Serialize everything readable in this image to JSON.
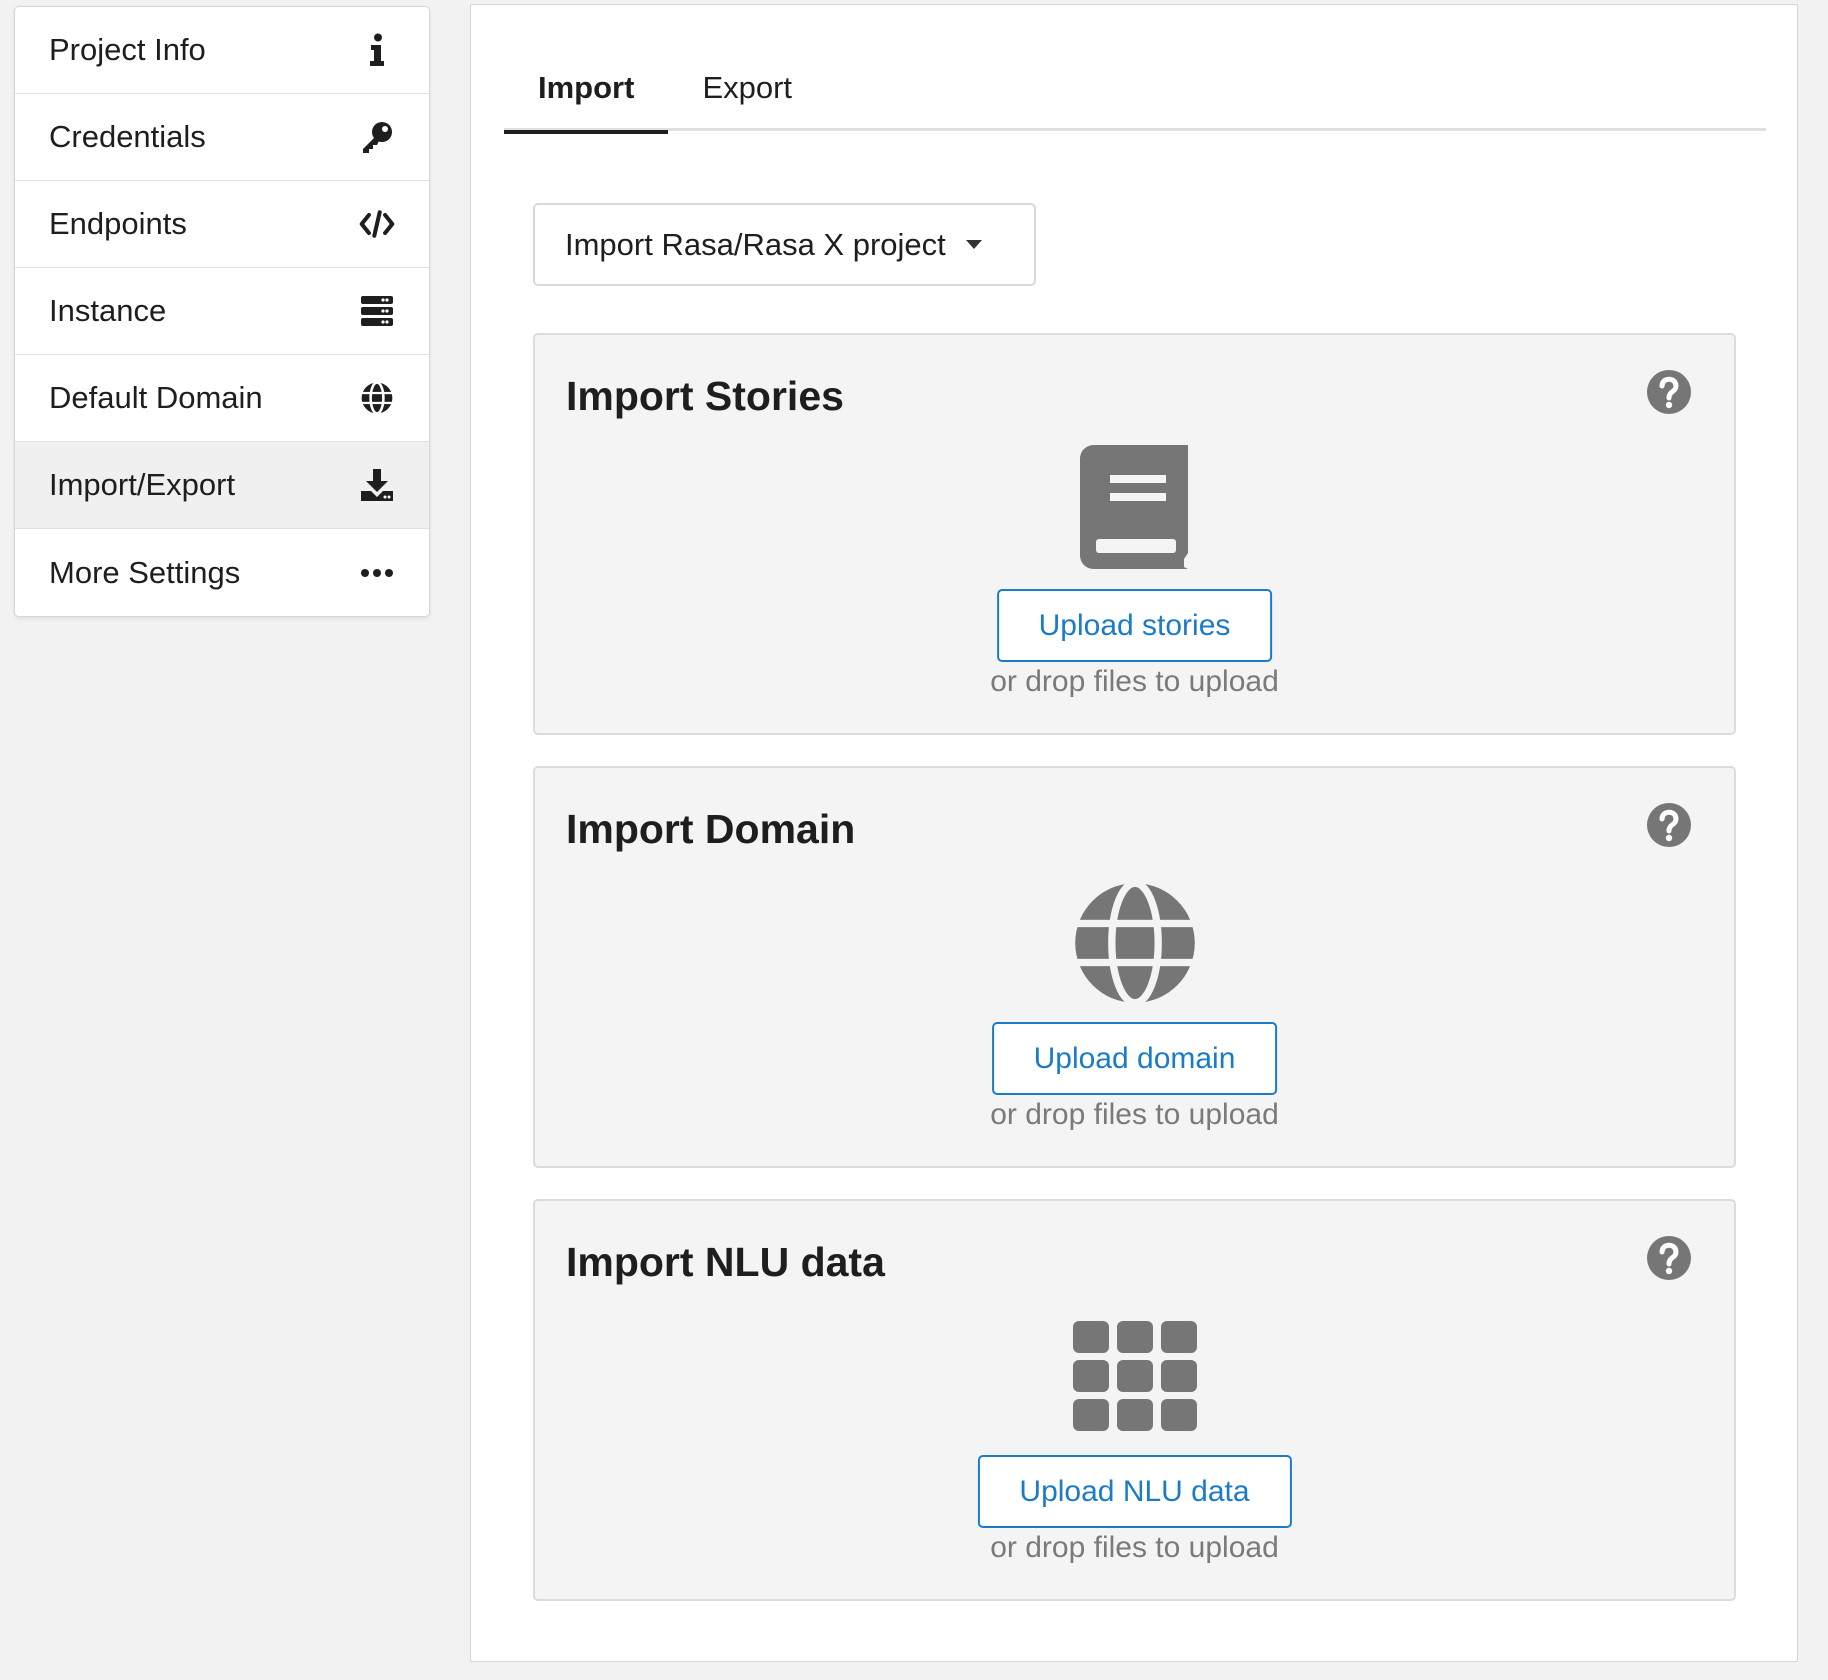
{
  "sidebar": {
    "items": [
      {
        "label": "Project Info",
        "icon": "info-icon"
      },
      {
        "label": "Credentials",
        "icon": "key-icon"
      },
      {
        "label": "Endpoints",
        "icon": "code-icon"
      },
      {
        "label": "Instance",
        "icon": "server-icon"
      },
      {
        "label": "Default Domain",
        "icon": "globe-icon"
      },
      {
        "label": "Import/Export",
        "icon": "download-icon",
        "active": true
      },
      {
        "label": "More Settings",
        "icon": "ellipsis-icon"
      }
    ]
  },
  "main": {
    "tabs": [
      {
        "label": "Import",
        "active": true
      },
      {
        "label": "Export"
      }
    ],
    "import_type": {
      "selected": "Import Rasa/Rasa X project"
    },
    "cards": [
      {
        "title": "Import Stories",
        "icon": "book-icon",
        "button_label": "Upload stories",
        "drop_text": "or drop files to upload"
      },
      {
        "title": "Import Domain",
        "icon": "globe-icon",
        "button_label": "Upload domain",
        "drop_text": "or drop files to upload"
      },
      {
        "title": "Import NLU data",
        "icon": "grid-icon",
        "button_label": "Upload NLU data",
        "drop_text": "or drop files to upload"
      }
    ]
  },
  "colors": {
    "accent": "#1b7bc9",
    "icon_gray": "#767676",
    "card_bg": "#f4f4f4",
    "page_bg": "#f2f2f2"
  }
}
